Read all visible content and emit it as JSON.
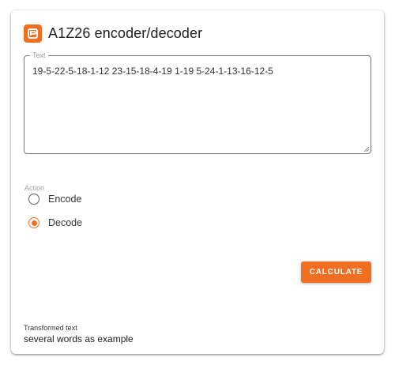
{
  "app": {
    "title": "A1Z26 encoder/decoder",
    "logo_icon": "planetcalc-logo-icon"
  },
  "colors": {
    "accent": "#f26f21"
  },
  "input": {
    "label": "Text",
    "value": "19-5-22-5-18-1-12 23-15-18-4-19 1-19 5-24-1-13-16-12-5"
  },
  "action": {
    "label": "Action",
    "options": [
      {
        "label": "Encode",
        "checked": false
      },
      {
        "label": "Decode",
        "checked": true
      }
    ]
  },
  "calculate_button": {
    "label": "CALCULATE"
  },
  "result": {
    "label": "Transformed text",
    "value": "several words as example"
  }
}
